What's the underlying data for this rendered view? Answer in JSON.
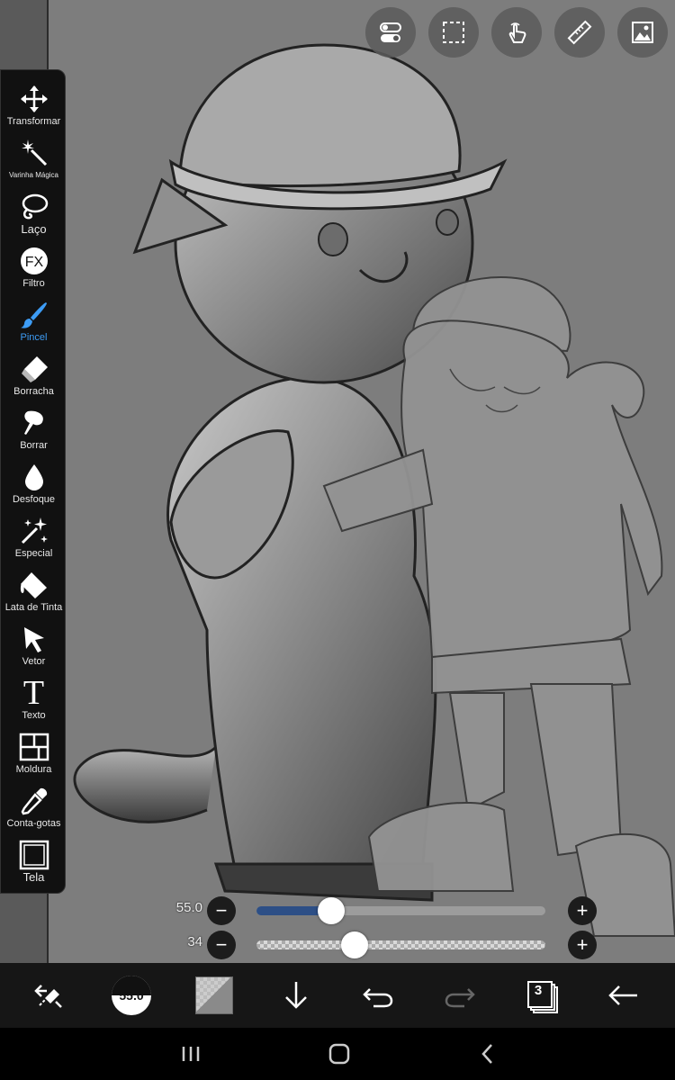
{
  "top_tools": [
    {
      "name": "layer-toggle-icon"
    },
    {
      "name": "selection-icon"
    },
    {
      "name": "touch-gesture-icon"
    },
    {
      "name": "ruler-icon"
    },
    {
      "name": "gallery-image-icon"
    }
  ],
  "toolbar": {
    "items": [
      {
        "label": "Transformar",
        "icon": "move-arrows-icon"
      },
      {
        "label": "Varinha Mágica",
        "icon": "magic-wand-icon"
      },
      {
        "label": "Laço",
        "icon": "lasso-icon"
      },
      {
        "label": "Filtro",
        "icon": "fx-icon"
      },
      {
        "label": "Pincel",
        "icon": "brush-icon",
        "active": true
      },
      {
        "label": "Borracha",
        "icon": "eraser-icon"
      },
      {
        "label": "Borrar",
        "icon": "smudge-icon"
      },
      {
        "label": "Desfoque",
        "icon": "blur-drop-icon"
      },
      {
        "label": "Especial",
        "icon": "sparkle-wand-icon"
      },
      {
        "label": "Lata de Tinta",
        "icon": "paint-bucket-icon"
      },
      {
        "label": "Vetor",
        "icon": "vector-cursor-icon"
      },
      {
        "label": "Texto",
        "icon": "text-t-icon"
      },
      {
        "label": "Moldura",
        "icon": "frame-icon"
      },
      {
        "label": "Conta-gotas",
        "icon": "eyedropper-icon"
      },
      {
        "label": "Tela",
        "icon": "canvas-icon"
      }
    ],
    "fx_glyph": "FX",
    "text_glyph": "T",
    "active_color": "#3d9cf5"
  },
  "sliders": {
    "size": {
      "value_label": "55.0",
      "fraction": 0.26
    },
    "opacity": {
      "value_label": "34",
      "fraction": 0.34
    }
  },
  "buttons": {
    "minus": "−",
    "plus": "+"
  },
  "bottom_bar": {
    "brush_size_label": "55.0",
    "layers_count": "3"
  },
  "colors": {
    "canvas_bg": "#7d7d7d",
    "slider_fill": "#2d4f86",
    "toolbar_bg": "#111111"
  }
}
